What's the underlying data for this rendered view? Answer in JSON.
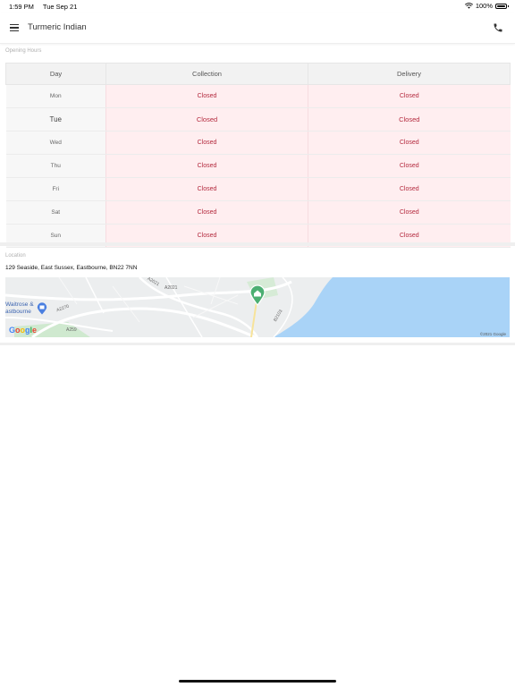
{
  "status": {
    "time": "1:59 PM",
    "date": "Tue Sep 21",
    "battery": "100%",
    "battery_level": 1.0
  },
  "header": {
    "title": "Turmeric Indian"
  },
  "hours": {
    "section_label": "Opening Hours",
    "columns": {
      "day": "Day",
      "collection": "Collection",
      "delivery": "Delivery"
    },
    "rows": [
      {
        "day": "Mon",
        "collection": "Closed",
        "delivery": "Closed"
      },
      {
        "day": "Tue",
        "collection": "Closed",
        "delivery": "Closed"
      },
      {
        "day": "Wed",
        "collection": "Closed",
        "delivery": "Closed"
      },
      {
        "day": "Thu",
        "collection": "Closed",
        "delivery": "Closed"
      },
      {
        "day": "Fri",
        "collection": "Closed",
        "delivery": "Closed"
      },
      {
        "day": "Sat",
        "collection": "Closed",
        "delivery": "Closed"
      },
      {
        "day": "Sun",
        "collection": "Closed",
        "delivery": "Closed"
      }
    ]
  },
  "location": {
    "section_label": "Location",
    "address": "129 Seaside, East Sussex, Eastbourne, BN22 7NN",
    "map": {
      "poi": "Waitrose & Eastbourne",
      "poi_line1": "Waitrose &",
      "poi_line2": "astbourne",
      "roads": [
        "A2021",
        "A2270",
        "A2021",
        "A259",
        "B2103"
      ],
      "credit": "©2021 Google",
      "logo": [
        "G",
        "o",
        "o",
        "g",
        "l",
        "e"
      ]
    }
  },
  "colors": {
    "closed_text": "#b42a3e",
    "closed_bg": "#ffeef0",
    "sea": "#a9d3f7",
    "marker": "#4caf72"
  }
}
